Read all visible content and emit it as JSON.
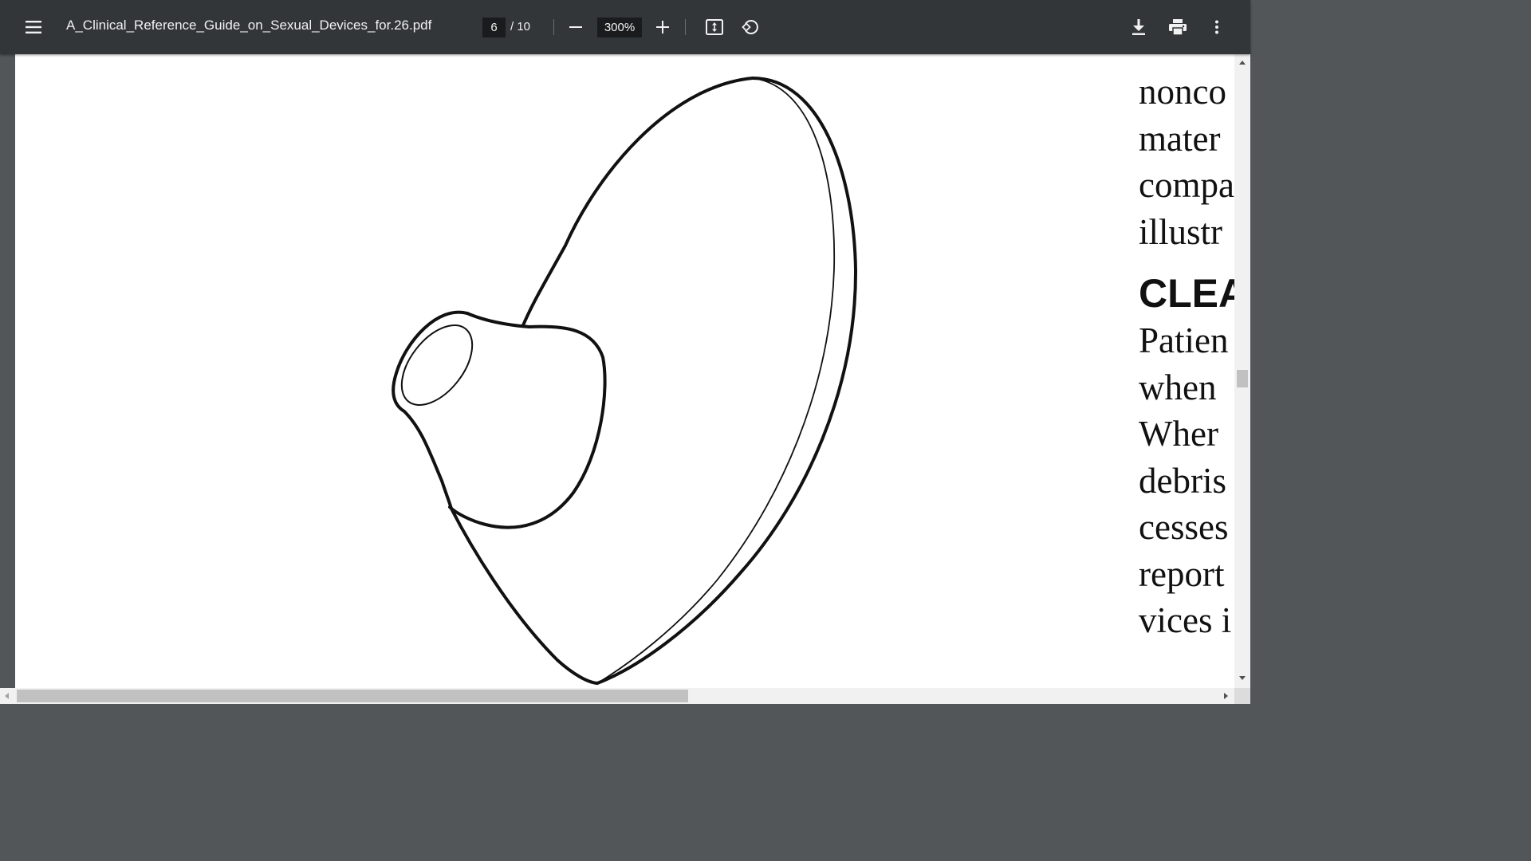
{
  "toolbar": {
    "filename": "A_Clinical_Reference_Guide_on_Sexual_Devices_for.26.pdf",
    "current_page": "6",
    "page_total": "/ 10",
    "zoom": "300%"
  },
  "icons": [
    "menu-icon",
    "zoom-out-icon",
    "zoom-in-icon",
    "fit-page-icon",
    "rotate-icon",
    "download-icon",
    "print-icon",
    "more-options-icon"
  ],
  "page": {
    "text_lines_top": [
      "nonco",
      "mater",
      "compa",
      "illustr"
    ],
    "heading": "CLEA",
    "text_lines_bottom": [
      "Patien",
      "when",
      "Wher",
      "debris",
      "cesses",
      "report",
      "vices i"
    ]
  },
  "colors": {
    "toolbar_bg": "#323639",
    "viewer_bg": "#525659",
    "page_bg": "#ffffff"
  }
}
